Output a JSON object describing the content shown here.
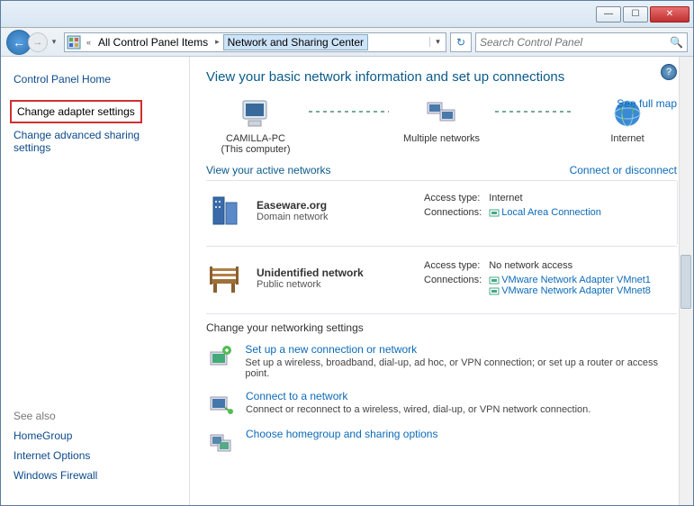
{
  "breadcrumbs": {
    "chevrons": "«",
    "item1": "All Control Panel Items",
    "item2": "Network and Sharing Center"
  },
  "search": {
    "placeholder": "Search Control Panel"
  },
  "sidebar": {
    "home": "Control Panel Home",
    "adapter": "Change adapter settings",
    "advanced": "Change advanced sharing settings",
    "seealso_hdr": "See also",
    "seealso": {
      "homegroup": "HomeGroup",
      "inetopts": "Internet Options",
      "firewall": "Windows Firewall"
    }
  },
  "main": {
    "heading": "View your basic network information and set up connections",
    "fullmap": "See full map",
    "map": {
      "pc_name": "CAMILLA-PC",
      "pc_sub": "(This computer)",
      "multi": "Multiple networks",
      "internet": "Internet"
    },
    "active_hdr": "View your active networks",
    "connect_link": "Connect or disconnect",
    "labels": {
      "access": "Access type:",
      "connections": "Connections:"
    },
    "net1": {
      "name": "Easeware.org",
      "type": "Domain network",
      "access": "Internet",
      "conn": "Local Area Connection"
    },
    "net2": {
      "name": "Unidentified network",
      "type": "Public network",
      "access": "No network access",
      "conn1": "VMware Network Adapter VMnet1",
      "conn2": "VMware Network Adapter VMnet8"
    },
    "settings_hdr": "Change your networking settings",
    "s1": {
      "title": "Set up a new connection or network",
      "desc": "Set up a wireless, broadband, dial-up, ad hoc, or VPN connection; or set up a router or access point."
    },
    "s2": {
      "title": "Connect to a network",
      "desc": "Connect or reconnect to a wireless, wired, dial-up, or VPN network connection."
    },
    "s3": {
      "title": "Choose homegroup and sharing options"
    }
  }
}
